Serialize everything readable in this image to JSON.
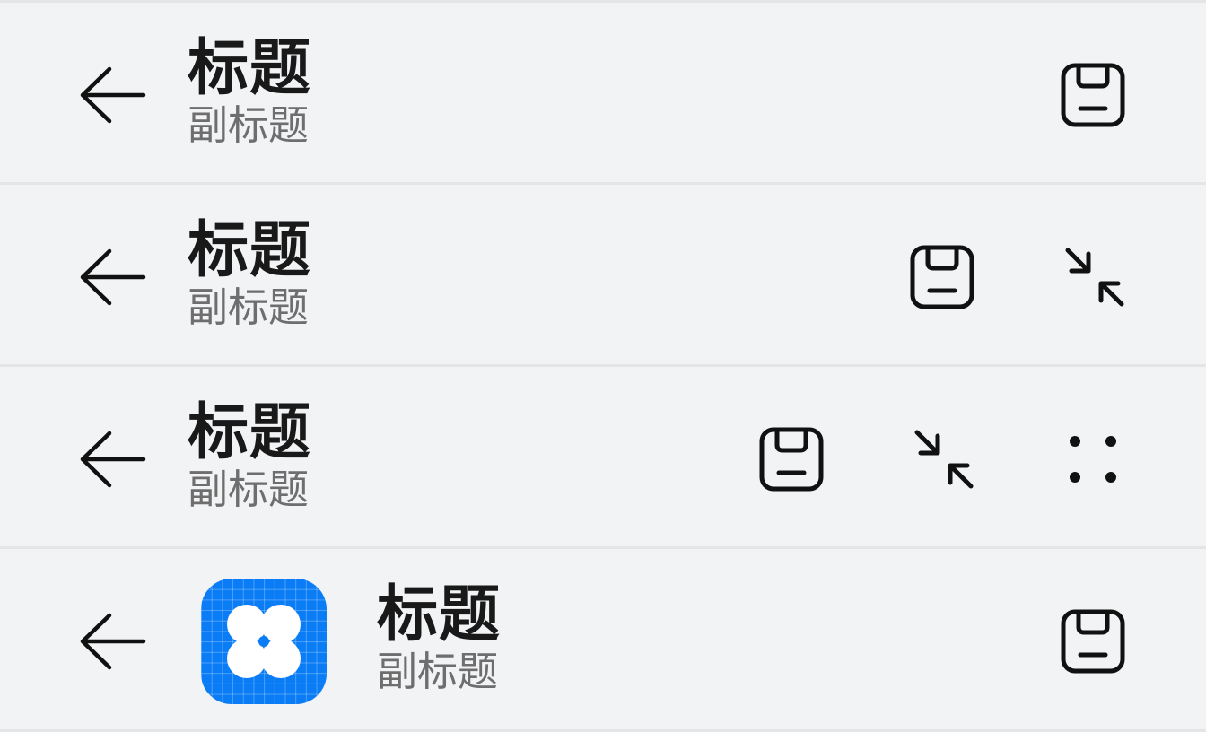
{
  "bars": [
    {
      "title": "标题",
      "subtitle": "副标题",
      "back_icon": "arrow-left-icon",
      "actions": [
        "save-icon"
      ]
    },
    {
      "title": "标题",
      "subtitle": "副标题",
      "back_icon": "arrow-left-icon",
      "actions": [
        "save-icon",
        "minimize-icon"
      ]
    },
    {
      "title": "标题",
      "subtitle": "副标题",
      "back_icon": "arrow-left-icon",
      "actions": [
        "save-icon",
        "minimize-icon",
        "more-dots-icon"
      ]
    },
    {
      "title": "标题",
      "subtitle": "副标题",
      "back_icon": "arrow-left-icon",
      "app_icon": "app-clover-icon",
      "actions": [
        "save-icon"
      ]
    }
  ],
  "colors": {
    "background": "#f1f3f5",
    "divider": "#e3e5e7",
    "title": "#191919",
    "subtitle": "#6e6e6e",
    "app_icon": "#0a7cf5"
  }
}
